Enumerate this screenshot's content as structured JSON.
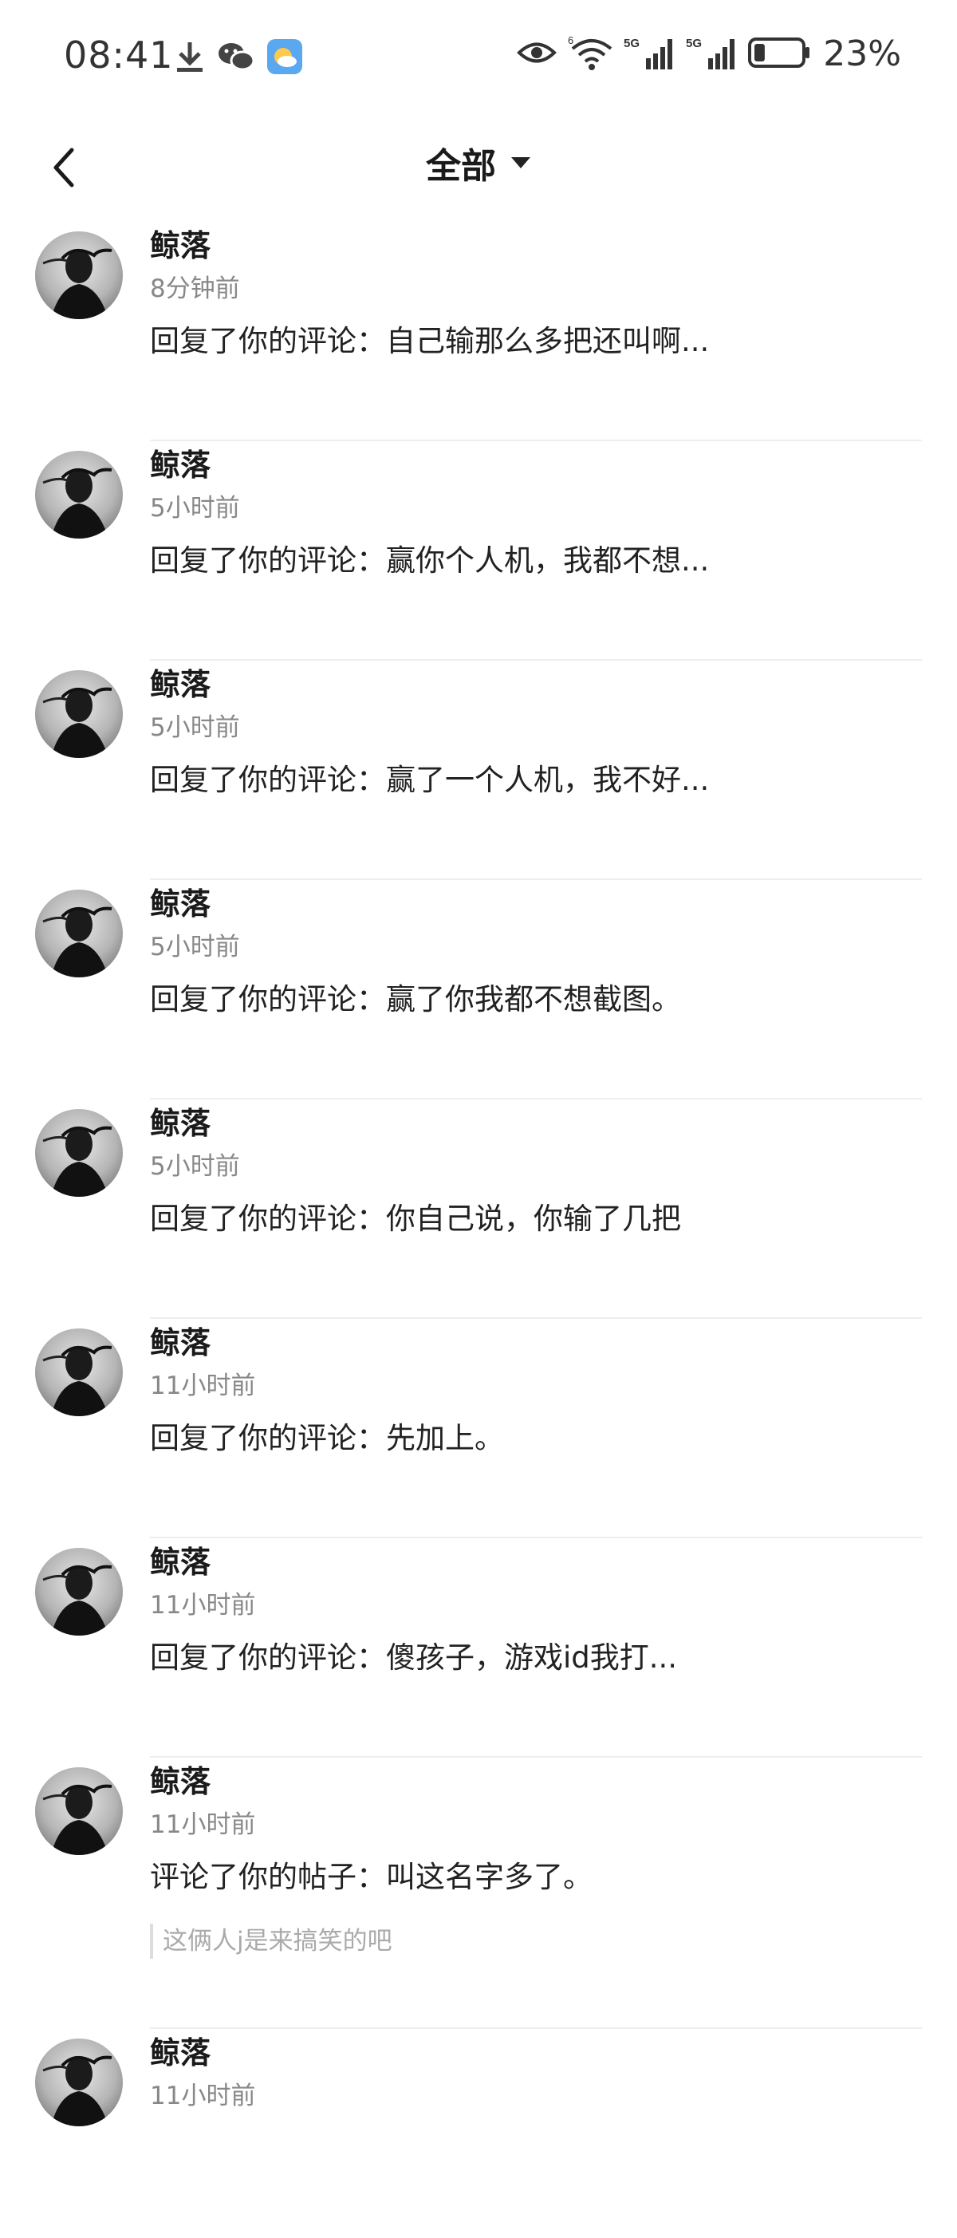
{
  "status_bar": {
    "time": "08:41",
    "battery_percent": "23%",
    "battery_level": 0.23,
    "network": [
      "5G",
      "5G"
    ]
  },
  "header": {
    "title": "全部"
  },
  "notifications": [
    {
      "name": "鲸落",
      "time": "8分钟前",
      "message": "回复了你的评论：自己输那么多把还叫啊..."
    },
    {
      "name": "鲸落",
      "time": "5小时前",
      "message": "回复了你的评论：赢你个人机，我都不想..."
    },
    {
      "name": "鲸落",
      "time": "5小时前",
      "message": "回复了你的评论：赢了一个人机，我不好..."
    },
    {
      "name": "鲸落",
      "time": "5小时前",
      "message": "回复了你的评论：赢了你我都不想截图。"
    },
    {
      "name": "鲸落",
      "time": "5小时前",
      "message": "回复了你的评论：你自己说，你输了几把"
    },
    {
      "name": "鲸落",
      "time": "11小时前",
      "message": "回复了你的评论：先加上。"
    },
    {
      "name": "鲸落",
      "time": "11小时前",
      "message": "回复了你的评论：傻孩子，游戏id我打..."
    },
    {
      "name": "鲸落",
      "time": "11小时前",
      "message": "评论了你的帖子：叫这名字多了。",
      "quote": "这俩人j是来搞笑的吧"
    },
    {
      "name": "鲸落",
      "time": "11小时前",
      "message": ""
    }
  ]
}
